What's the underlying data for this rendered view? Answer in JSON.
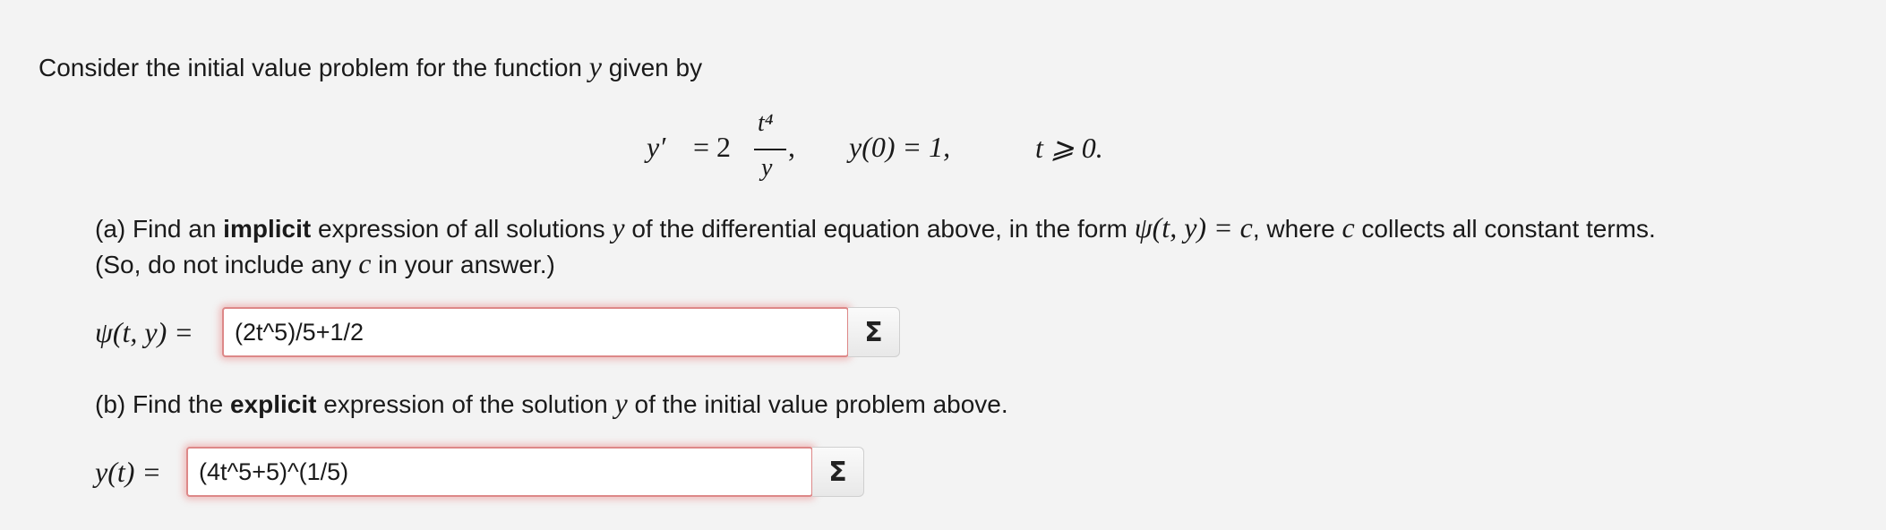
{
  "intro": {
    "before": "Consider the initial value problem for the function ",
    "var": "y",
    "after": " given by"
  },
  "equation": {
    "lhs": "y′",
    "equals_two": "= 2",
    "numerator": "t⁴",
    "denominator": "y",
    "comma": ",",
    "initial_condition": "y(0) = 1,",
    "domain": "t ⩾ 0."
  },
  "part_a": {
    "line1_before": "(a) Find an ",
    "line1_bold": "implicit",
    "line1_mid": " expression of all solutions ",
    "line1_var": "y",
    "line1_mid2": " of the differential equation above, in the form ",
    "line1_form": "ψ(t, y) = c",
    "line1_mid3": ", where ",
    "line1_c": "c",
    "line1_after": " collects all constant terms.",
    "line2_before": "(So, do not include any ",
    "line2_c": "c",
    "line2_after": " in your answer.)",
    "answer_label": "ψ(t, y) =",
    "answer_value": "(2t^5)/5+1/2",
    "sigma": "Σ"
  },
  "part_b": {
    "line_before": "(b) Find the ",
    "line_bold": "explicit",
    "line_mid": " expression of the solution ",
    "line_var": "y",
    "line_after": " of the initial value problem above.",
    "answer_label": "y(t) =",
    "answer_value": "(4t^5+5)^(1/5)",
    "sigma": "Σ"
  },
  "colors": {
    "background": "#f3f3f3",
    "input_border": "#dd8888",
    "input_glow": "#e65a5a"
  }
}
